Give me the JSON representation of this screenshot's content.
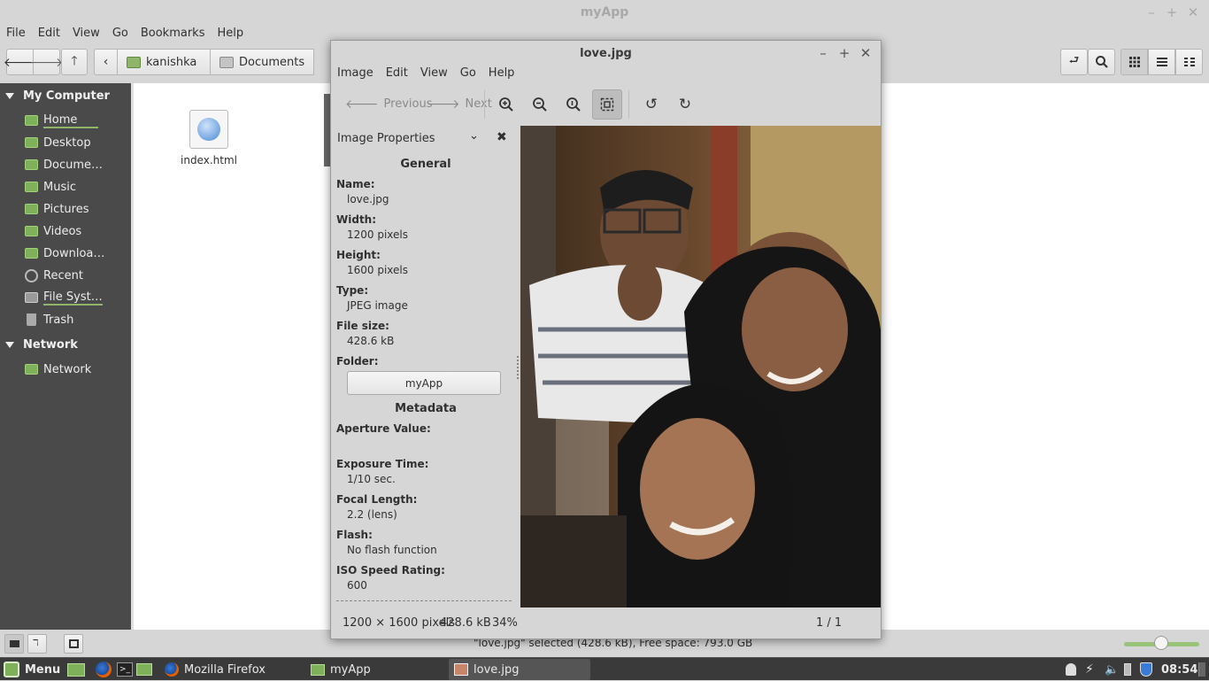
{
  "filemanager": {
    "title": "myApp",
    "menu": [
      "File",
      "Edit",
      "View",
      "Go",
      "Bookmarks",
      "Help"
    ],
    "path": [
      "kanishka",
      "Documents"
    ],
    "sidebar": {
      "computer_head": "My Computer",
      "items": [
        "Home",
        "Desktop",
        "Docume…",
        "Music",
        "Pictures",
        "Videos",
        "Downloa…",
        "Recent",
        "File Syst…",
        "Trash"
      ],
      "network_head": "Network",
      "network_items": [
        "Network"
      ]
    },
    "files": [
      {
        "name": "index.html"
      }
    ],
    "status": "\"love.jpg\" selected (428.6 kB), Free space: 793.0 GB"
  },
  "viewer": {
    "title": "love.jpg",
    "menu": [
      "Image",
      "Edit",
      "View",
      "Go",
      "Help"
    ],
    "prev_label": "Previous",
    "next_label": "Next",
    "props": {
      "header": "Image Properties",
      "general": "General",
      "name_label": "Name:",
      "name": "love.jpg",
      "width_label": "Width:",
      "width": "1200 pixels",
      "height_label": "Height:",
      "height": "1600 pixels",
      "type_label": "Type:",
      "type": "JPEG image",
      "size_label": "File size:",
      "size": "428.6 kB",
      "folder_label": "Folder:",
      "folder": "myApp",
      "metadata": "Metadata",
      "aperture_label": "Aperture Value:",
      "aperture": "",
      "exposure_label": "Exposure Time:",
      "exposure": "1/10 sec.",
      "focal_label": "Focal Length:",
      "focal": "2.2 (lens)",
      "flash_label": "Flash:",
      "flash": "No flash function",
      "iso_label": "ISO Speed Rating:",
      "iso": "600"
    },
    "status": {
      "dims": "1200 × 1600 pixels",
      "size": "428.6 kB",
      "zoom": "34%",
      "page": "1 / 1"
    }
  },
  "taskbar": {
    "menu": "Menu",
    "tasks": [
      "Mozilla Firefox",
      "myApp",
      "love.jpg"
    ],
    "clock": "08:54"
  },
  "colors": {
    "accent": "#8fb46a",
    "sidebar": "#4a4a4a",
    "taskbar": "#3a3a3a"
  }
}
